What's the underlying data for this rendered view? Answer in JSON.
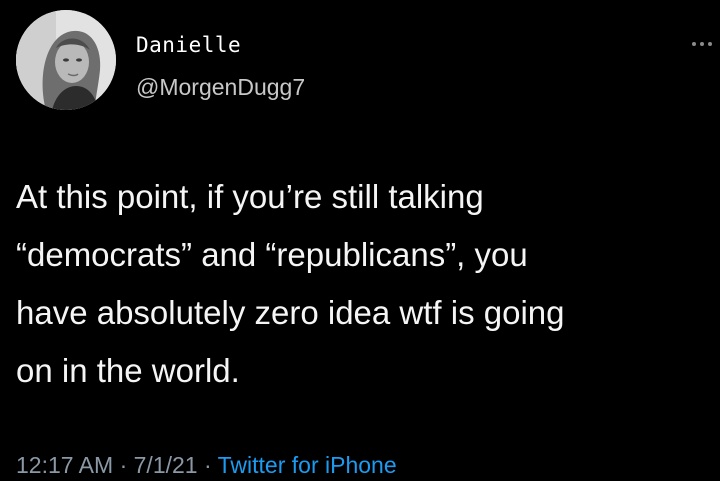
{
  "tweet": {
    "display_name": "Danielle",
    "handle": "@MorgenDugg7",
    "more_icon": "more-horizontal-icon",
    "text": "At this point, if you’re still talking\n“democrats” and “republicans”, you\nhave absolutely zero idea wtf is going\non in the world.",
    "time": "12:17 AM",
    "separator": "·",
    "date": "7/1/21",
    "source": "Twitter for iPhone"
  },
  "colors": {
    "background": "#000000",
    "text": "#ffffff",
    "muted": "#8b98a5",
    "link": "#1d9bf0"
  }
}
